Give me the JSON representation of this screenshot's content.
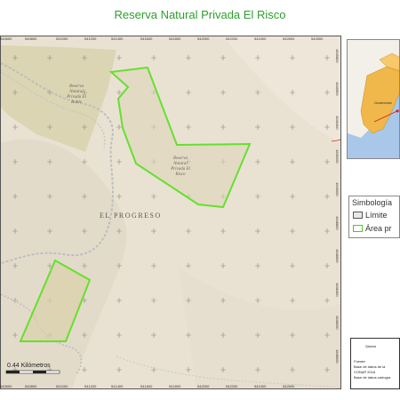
{
  "title": "Reserva Natural Privada El Risco",
  "map": {
    "x_ticks": [
      "540600",
      "540800",
      "541000",
      "541200",
      "541400",
      "541600",
      "541800",
      "542000",
      "542200",
      "542400",
      "542600",
      "542800"
    ],
    "y_ticks": [
      "1649800",
      "1649600",
      "1649400",
      "1649200",
      "1649000",
      "1648800",
      "1648600",
      "1648400",
      "1648200",
      "1648000"
    ],
    "labels": {
      "reserve_el_roble": [
        "Reserva",
        "Natural",
        "Privada El",
        "Roble"
      ],
      "reserve_el_risco": [
        "Reserva",
        "Natural",
        "Privada El",
        "Risco"
      ],
      "region": "EL PROGRESO"
    },
    "scale_text": "0.44 Kilómetros",
    "colors": {
      "reserve_outline": "#66e02e",
      "terrain": "#e9e2d3",
      "road": "#bdbdbd"
    }
  },
  "inset": {
    "label": "Guatemala"
  },
  "legend": {
    "title": "Simbología",
    "items": [
      {
        "label": "Límite",
        "swatch_fill": "#e8e8e8",
        "swatch_border": "#555555"
      },
      {
        "label": "Área pr",
        "swatch_fill": "#ffffff",
        "swatch_border": "#44cc22"
      }
    ]
  },
  "sources": {
    "heading": "Sistem",
    "label": "Fuente:",
    "lines": [
      "Base de datos de la",
      "CONAP 2016",
      "Base de datos cartogra"
    ]
  }
}
